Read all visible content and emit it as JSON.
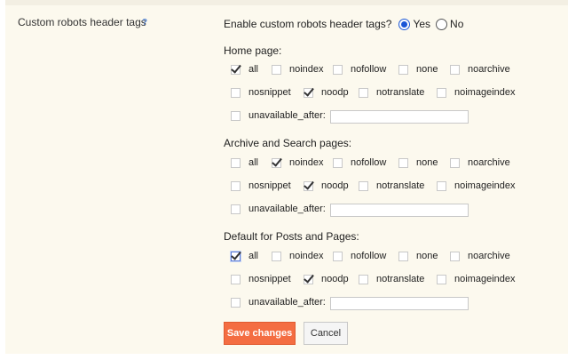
{
  "setting_label": "Custom robots header tags",
  "help_icon": "?",
  "enable_question": "Enable custom robots header tags?",
  "radio_yes": "Yes",
  "radio_no": "No",
  "sections": [
    {
      "title": "Home page:",
      "options": [
        {
          "label": "all",
          "checked": true
        },
        {
          "label": "noindex",
          "checked": false
        },
        {
          "label": "nofollow",
          "checked": false
        },
        {
          "label": "none",
          "checked": false
        },
        {
          "label": "noarchive",
          "checked": false
        },
        {
          "label": "nosnippet",
          "checked": false
        },
        {
          "label": "noodp",
          "checked": true
        },
        {
          "label": "notranslate",
          "checked": false
        },
        {
          "label": "noimageindex",
          "checked": false
        },
        {
          "label": "unavailable_after:",
          "checked": false
        }
      ],
      "unavailable_after_value": ""
    },
    {
      "title": "Archive and Search pages:",
      "options": [
        {
          "label": "all",
          "checked": false
        },
        {
          "label": "noindex",
          "checked": true
        },
        {
          "label": "nofollow",
          "checked": false
        },
        {
          "label": "none",
          "checked": false
        },
        {
          "label": "noarchive",
          "checked": false
        },
        {
          "label": "nosnippet",
          "checked": false
        },
        {
          "label": "noodp",
          "checked": true
        },
        {
          "label": "notranslate",
          "checked": false
        },
        {
          "label": "noimageindex",
          "checked": false
        },
        {
          "label": "unavailable_after:",
          "checked": false
        }
      ],
      "unavailable_after_value": ""
    },
    {
      "title": "Default for Posts and Pages:",
      "options": [
        {
          "label": "all",
          "checked": true
        },
        {
          "label": "noindex",
          "checked": false
        },
        {
          "label": "nofollow",
          "checked": false
        },
        {
          "label": "none",
          "checked": false
        },
        {
          "label": "noarchive",
          "checked": false
        },
        {
          "label": "nosnippet",
          "checked": false
        },
        {
          "label": "noodp",
          "checked": true
        },
        {
          "label": "notranslate",
          "checked": false
        },
        {
          "label": "noimageindex",
          "checked": false
        },
        {
          "label": "unavailable_after:",
          "checked": false
        }
      ],
      "unavailable_after_value": ""
    }
  ],
  "save_label": "Save changes",
  "cancel_label": "Cancel",
  "colors": {
    "panel_bg": "#fcf9ee",
    "save_bg": "#f46d42",
    "radio_accent": "#1a56d6"
  }
}
